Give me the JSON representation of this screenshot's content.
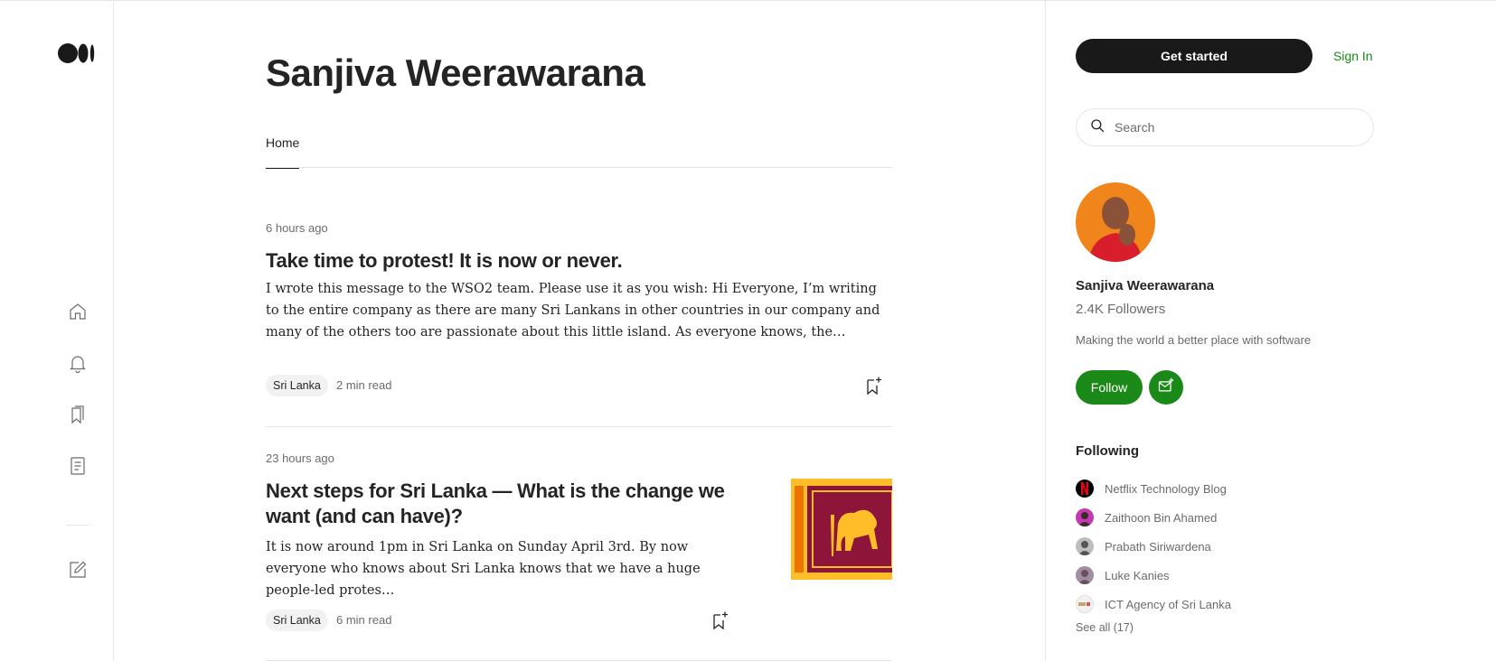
{
  "rail": {
    "icons": [
      "medium-logo",
      "home-icon",
      "bell-icon",
      "bookmarks-icon",
      "stories-icon",
      "write-icon"
    ]
  },
  "author": {
    "name": "Sanjiva Weerawarana"
  },
  "tabs": {
    "home": "Home"
  },
  "posts": [
    {
      "time": "6 hours ago",
      "title": "Take time to protest! It is now or never.",
      "excerpt": "I wrote this message to the WSO2 team. Please use it as you wish: Hi Everyone, I’m writing to the entire company as there are many Sri Lankans in other countries in our company and many of the others too are passionate about this little island. As everyone knows, the…",
      "tag": "Sri Lanka",
      "read_time": "2 min read"
    },
    {
      "time": "23 hours ago",
      "title": "Next steps for Sri Lanka — What is the change we want (and can have)?",
      "excerpt": "It is now around 1pm in Sri Lanka on Sunday April 3rd. By now everyone who knows about Sri Lanka knows that we have a huge people-led protes…",
      "tag": "Sri Lanka",
      "read_time": "6 min read"
    }
  ],
  "header_actions": {
    "get_started": "Get started",
    "sign_in": "Sign In"
  },
  "search": {
    "placeholder": "Search"
  },
  "profile": {
    "name": "Sanjiva Weerawarana",
    "followers": "2.4K Followers",
    "bio": "Making the world a better place with software",
    "follow_label": "Follow"
  },
  "following": {
    "title": "Following",
    "items": [
      {
        "name": "Netflix Technology Blog"
      },
      {
        "name": "Zaithoon Bin Ahamed"
      },
      {
        "name": "Prabath Siriwardena"
      },
      {
        "name": "Luke Kanies"
      },
      {
        "name": "ICT Agency of Sri Lanka"
      }
    ],
    "see_all": "See all (17)"
  },
  "colors": {
    "accent_green": "#1a8917",
    "dark_button": "#191919",
    "muted_text": "#6b6b6b"
  }
}
